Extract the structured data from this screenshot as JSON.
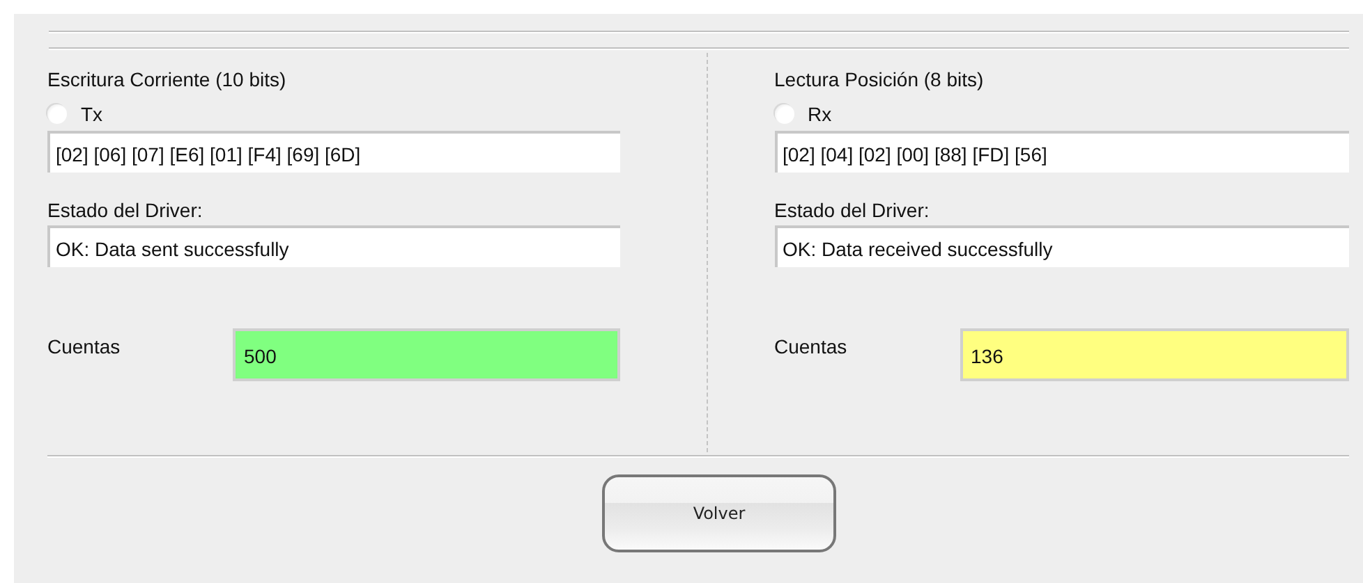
{
  "panels": [
    {
      "title": "Escritura Corriente (10 bits)",
      "radio": {
        "label": "Tx",
        "selected": false
      },
      "frame": "[02] [06] [07] [E6] [01] [F4] [69] [6D]",
      "status_label": "Estado del Driver:",
      "status": "OK: Data sent successfully",
      "counts_label": "Cuentas",
      "counts": {
        "value": "500",
        "color": "#80ff80"
      }
    },
    {
      "title": "Lectura Posición (8 bits)",
      "radio": {
        "label": "Rx",
        "selected": false
      },
      "frame": "[02] [04] [02] [00] [88] [FD] [56]",
      "status_label": "Estado del Driver:",
      "status": "OK: Data received successfully",
      "counts_label": "Cuentas",
      "counts": {
        "value": "136",
        "color": "#ffff80"
      }
    }
  ],
  "button": "Volver"
}
